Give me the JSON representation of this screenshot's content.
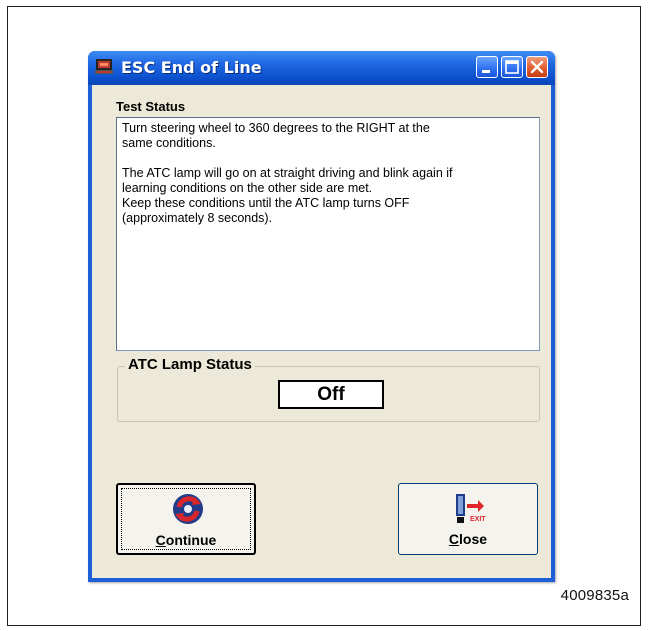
{
  "window": {
    "title": "ESC End of Line",
    "title_bar_color": "#0b4fcc",
    "controls": [
      "minimize-icon",
      "maximize-icon",
      "close-icon"
    ]
  },
  "test_status": {
    "label": "Test Status",
    "text": "Turn steering wheel to 360 degrees to the RIGHT at the\nsame conditions.\n\nThe ATC lamp will go on at straight driving and blink again if\nlearning conditions on the other side are met.\nKeep these conditions until the ATC lamp turns OFF\n(approximately 8 seconds)."
  },
  "atc_lamp": {
    "label": "ATC Lamp Status",
    "value": "Off"
  },
  "buttons": {
    "continue": {
      "label": "Continue",
      "mnemonic": "C",
      "rest": "ontinue",
      "icon": "refresh-icon"
    },
    "close": {
      "label": "Close",
      "mnemonic": "C",
      "rest": "lose",
      "icon": "exit-icon"
    }
  },
  "figure_id": "4009835a"
}
